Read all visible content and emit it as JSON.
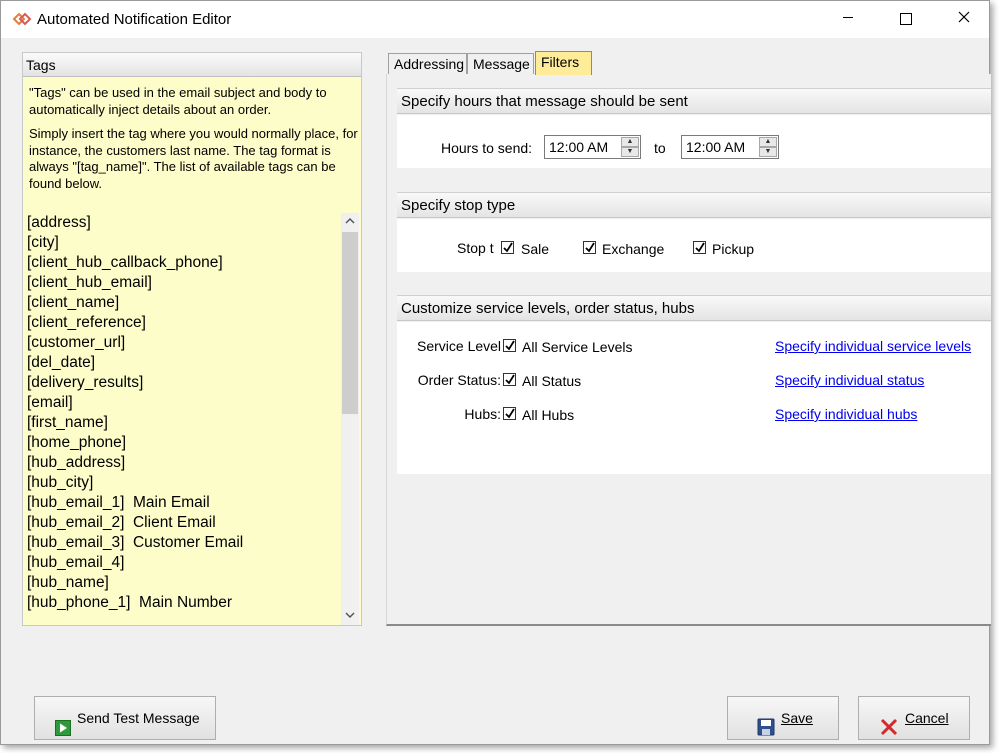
{
  "window": {
    "title": "Automated Notification Editor"
  },
  "tags_panel": {
    "header": "Tags",
    "description_1": "\"Tags\" can be used in the email subject and body to automatically inject details about an order.",
    "description_2": "Simply insert the tag where you would normally place, for instance, the customers last name.  The tag format is always \"[tag_name]\".  The list of available tags can be found below.",
    "tags": [
      "[address]",
      "[city]",
      "[client_hub_callback_phone]",
      "[client_hub_email]",
      "[client_name]",
      "[client_reference]",
      "[customer_url]",
      "[del_date]",
      "[delivery_results]",
      "[email]",
      "[first_name]",
      "[home_phone]",
      "[hub_address]",
      "[hub_city]",
      "[hub_email_1]  Main Email",
      "[hub_email_2]  Client Email",
      "[hub_email_3]  Customer Email",
      "[hub_email_4]",
      "[hub_name]",
      "[hub_phone_1]  Main Number"
    ]
  },
  "tabs": [
    {
      "label": "Addressing"
    },
    {
      "label": "Message"
    },
    {
      "label": "Filters"
    }
  ],
  "hours_section": {
    "header": "Specify hours that message should be sent",
    "label": "Hours to send:",
    "from_value": "12:00 AM",
    "to_label": "to",
    "to_value": "12:00 AM"
  },
  "stop_section": {
    "header": "Specify stop type",
    "label": "Stop type:",
    "options": [
      {
        "label": "Sale",
        "checked": true
      },
      {
        "label": "Exchange",
        "checked": true
      },
      {
        "label": "Pickup",
        "checked": true
      }
    ]
  },
  "levels_section": {
    "header": "Customize service levels, order status, hubs",
    "rows": [
      {
        "label": "Service Level:",
        "checkbox_label": "All Service Levels",
        "checked": true,
        "link": "Specify individual service levels"
      },
      {
        "label": "Order Status:",
        "checkbox_label": "All Status",
        "checked": true,
        "link": "Specify individual status"
      },
      {
        "label": "Hubs:",
        "checkbox_label": "All Hubs",
        "checked": true,
        "link": "Specify individual hubs"
      }
    ]
  },
  "buttons": {
    "send_test": "Send Test Message",
    "save": "Save",
    "cancel": "Cancel"
  }
}
